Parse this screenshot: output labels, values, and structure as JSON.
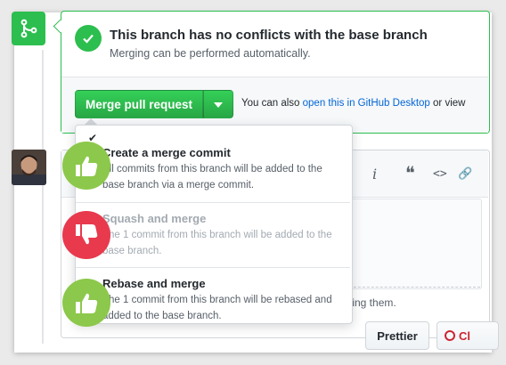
{
  "status": {
    "title": "This branch has no conflicts with the base branch",
    "subtitle": "Merging can be performed automatically."
  },
  "actions": {
    "merge_label": "Merge pull request",
    "also_prefix": "You can also ",
    "also_link": "open this in GitHub Desktop",
    "also_suffix": " or view"
  },
  "merge_options": [
    {
      "title": "Create a merge commit",
      "description": "All commits from this branch will be added to the base branch via a merge commit.",
      "enabled": true,
      "reaction": "thumbs-up-icon"
    },
    {
      "title": "Squash and merge",
      "description": "The 1 commit from this branch will be added to the base branch.",
      "enabled": false,
      "reaction": "thumbs-down-icon"
    },
    {
      "title": "Rebase and merge",
      "description": "The 1 commit from this branch will be rebased and added to the base branch.",
      "enabled": true,
      "reaction": "thumbs-up-icon"
    }
  ],
  "toolbar": {
    "italic_glyph": "i",
    "quote_glyph": "❝",
    "code_glyph": "<>",
    "link_glyph": "🔗"
  },
  "editor": {
    "hint_text": "ting them."
  },
  "buttons": {
    "prettier_label": "Prettier",
    "close_label": "Cl"
  },
  "colors": {
    "success": "#2cbe4e",
    "thumb_up": "#8cc84b",
    "thumb_down": "#e8394d",
    "link": "#0366d6"
  }
}
